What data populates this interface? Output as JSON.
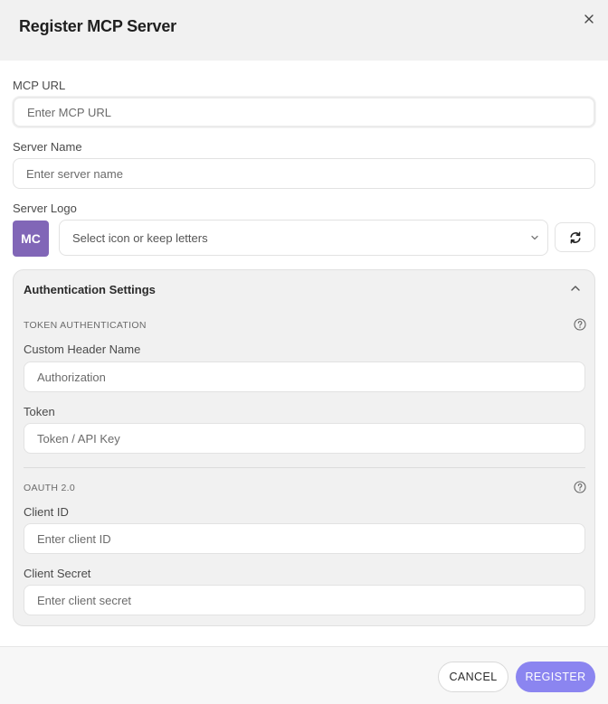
{
  "dialog": {
    "title": "Register MCP Server",
    "close_icon": "close-icon"
  },
  "form": {
    "mcp_url": {
      "label": "MCP URL",
      "placeholder": "Enter MCP URL",
      "value": ""
    },
    "server_name": {
      "label": "Server Name",
      "placeholder": "Enter server name",
      "value": ""
    },
    "server_logo": {
      "label": "Server Logo",
      "badge_text": "MC",
      "badge_color": "#8166b7",
      "select_placeholder": "Select icon or keep letters",
      "refresh_icon": "refresh-icon"
    }
  },
  "auth": {
    "title": "Authentication Settings",
    "token_section": {
      "caption": "TOKEN AUTHENTICATION",
      "header_label": "Custom Header Name",
      "header_placeholder": "Authorization",
      "token_label": "Token",
      "token_placeholder": "Token / API Key"
    },
    "oauth_section": {
      "caption": "OAUTH 2.0",
      "client_id_label": "Client ID",
      "client_id_placeholder": "Enter client ID",
      "client_secret_label": "Client Secret",
      "client_secret_placeholder": "Enter client secret"
    }
  },
  "footer": {
    "cancel_label": "CANCEL",
    "register_label": "REGISTER",
    "accent_color": "#8b85f0"
  }
}
